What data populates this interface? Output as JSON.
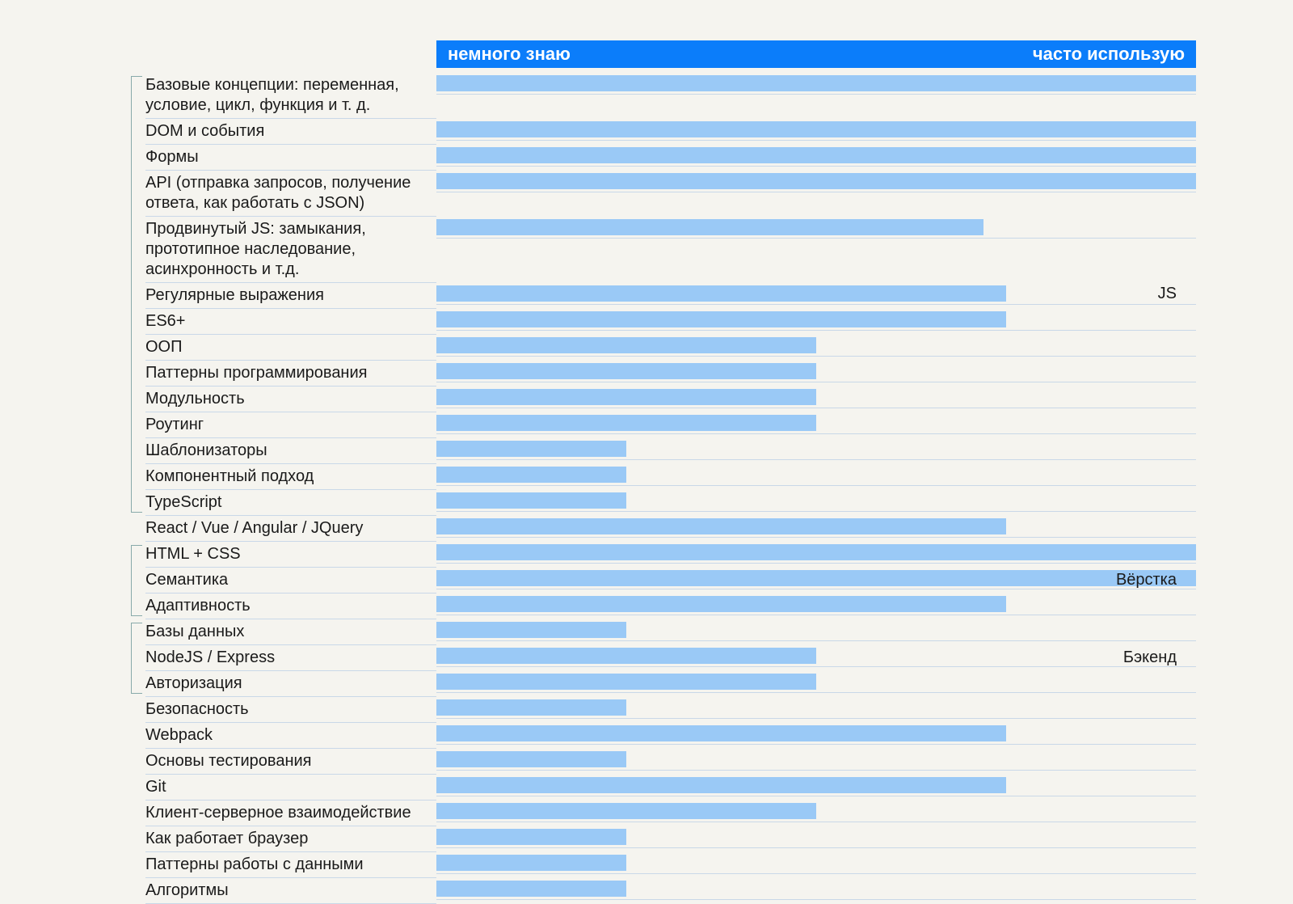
{
  "header": {
    "left_label": "немного знаю",
    "right_label": "часто использую"
  },
  "categories": [
    {
      "name": "JS",
      "start": 0,
      "end": 13
    },
    {
      "name": "Вёрстка",
      "start": 15,
      "end": 17
    },
    {
      "name": "Бэкенд",
      "start": 18,
      "end": 20
    }
  ],
  "rows": [
    {
      "label": "Базовые концепции: переменная, условие, цикл, функция и т. д.",
      "value": 100
    },
    {
      "label": "DOM и события",
      "value": 100
    },
    {
      "label": "Формы",
      "value": 100
    },
    {
      "label": "API (отправка запросов, получение ответа, как работать с JSON)",
      "value": 100
    },
    {
      "label": "Продвинутый JS: замыкания, прототипное наследование, асинхронность и т.д.",
      "value": 72
    },
    {
      "label": "Регулярные выражения",
      "value": 75
    },
    {
      "label": "ES6+",
      "value": 75
    },
    {
      "label": "ООП",
      "value": 50
    },
    {
      "label": "Паттерны программирования",
      "value": 50
    },
    {
      "label": "Модульность",
      "value": 50
    },
    {
      "label": "Роутинг",
      "value": 50
    },
    {
      "label": "Шаблонизаторы",
      "value": 25
    },
    {
      "label": "Компонентный подход",
      "value": 25
    },
    {
      "label": "TypeScript",
      "value": 25
    },
    {
      "label": "React / Vue / Angular / JQuery",
      "value": 75
    },
    {
      "label": "HTML + CSS",
      "value": 100
    },
    {
      "label": "Семантика",
      "value": 100
    },
    {
      "label": "Адаптивность",
      "value": 75
    },
    {
      "label": "Базы данных",
      "value": 25
    },
    {
      "label": "NodeJS / Express",
      "value": 50
    },
    {
      "label": "Авторизация",
      "value": 50
    },
    {
      "label": "Безопасность",
      "value": 25
    },
    {
      "label": "Webpack",
      "value": 75
    },
    {
      "label": "Основы тестирования",
      "value": 25
    },
    {
      "label": "Git",
      "value": 75
    },
    {
      "label": "Клиент-серверное взаимодействие",
      "value": 50
    },
    {
      "label": "Как работает браузер",
      "value": 25
    },
    {
      "label": "Паттерны работы с данными",
      "value": 25
    },
    {
      "label": "Алгоритмы",
      "value": 25
    }
  ],
  "chart_data": {
    "type": "bar",
    "orientation": "horizontal",
    "title": "",
    "xlabel_left": "немного знаю",
    "xlabel_right": "часто использую",
    "xlim": [
      0,
      100
    ],
    "groups": [
      {
        "name": "JS",
        "items": [
          "Базовые концепции: переменная, условие, цикл, функция и т. д.",
          "DOM и события",
          "Формы",
          "API (отправка запросов, получение ответа, как работать с JSON)",
          "Продвинутый JS: замыкания, прототипное наследование, асинхронность и т.д.",
          "Регулярные выражения",
          "ES6+",
          "ООП",
          "Паттерны программирования",
          "Модульность",
          "Роутинг",
          "Шаблонизаторы",
          "Компонентный подход",
          "TypeScript"
        ]
      },
      {
        "name": "Вёрстка",
        "items": [
          "HTML + CSS",
          "Семантика",
          "Адаптивность"
        ]
      },
      {
        "name": "Бэкенд",
        "items": [
          "Базы данных",
          "NodeJS / Express",
          "Авторизация"
        ]
      }
    ],
    "categories": [
      "Базовые концепции: переменная, условие, цикл, функция и т. д.",
      "DOM и события",
      "Формы",
      "API (отправка запросов, получение ответа, как работать с JSON)",
      "Продвинутый JS: замыкания, прототипное наследование, асинхронность и т.д.",
      "Регулярные выражения",
      "ES6+",
      "ООП",
      "Паттерны программирования",
      "Модульность",
      "Роутинг",
      "Шаблонизаторы",
      "Компонентный подход",
      "TypeScript",
      "React / Vue / Angular / JQuery",
      "HTML + CSS",
      "Семантика",
      "Адаптивность",
      "Базы данных",
      "NodeJS / Express",
      "Авторизация",
      "Безопасность",
      "Webpack",
      "Основы тестирования",
      "Git",
      "Клиент-серверное взаимодействие",
      "Как работает браузер",
      "Паттерны работы с данными",
      "Алгоритмы"
    ],
    "values": [
      100,
      100,
      100,
      100,
      72,
      75,
      75,
      50,
      50,
      50,
      50,
      25,
      25,
      25,
      75,
      100,
      100,
      75,
      25,
      50,
      50,
      25,
      75,
      25,
      75,
      50,
      25,
      25,
      25
    ]
  }
}
